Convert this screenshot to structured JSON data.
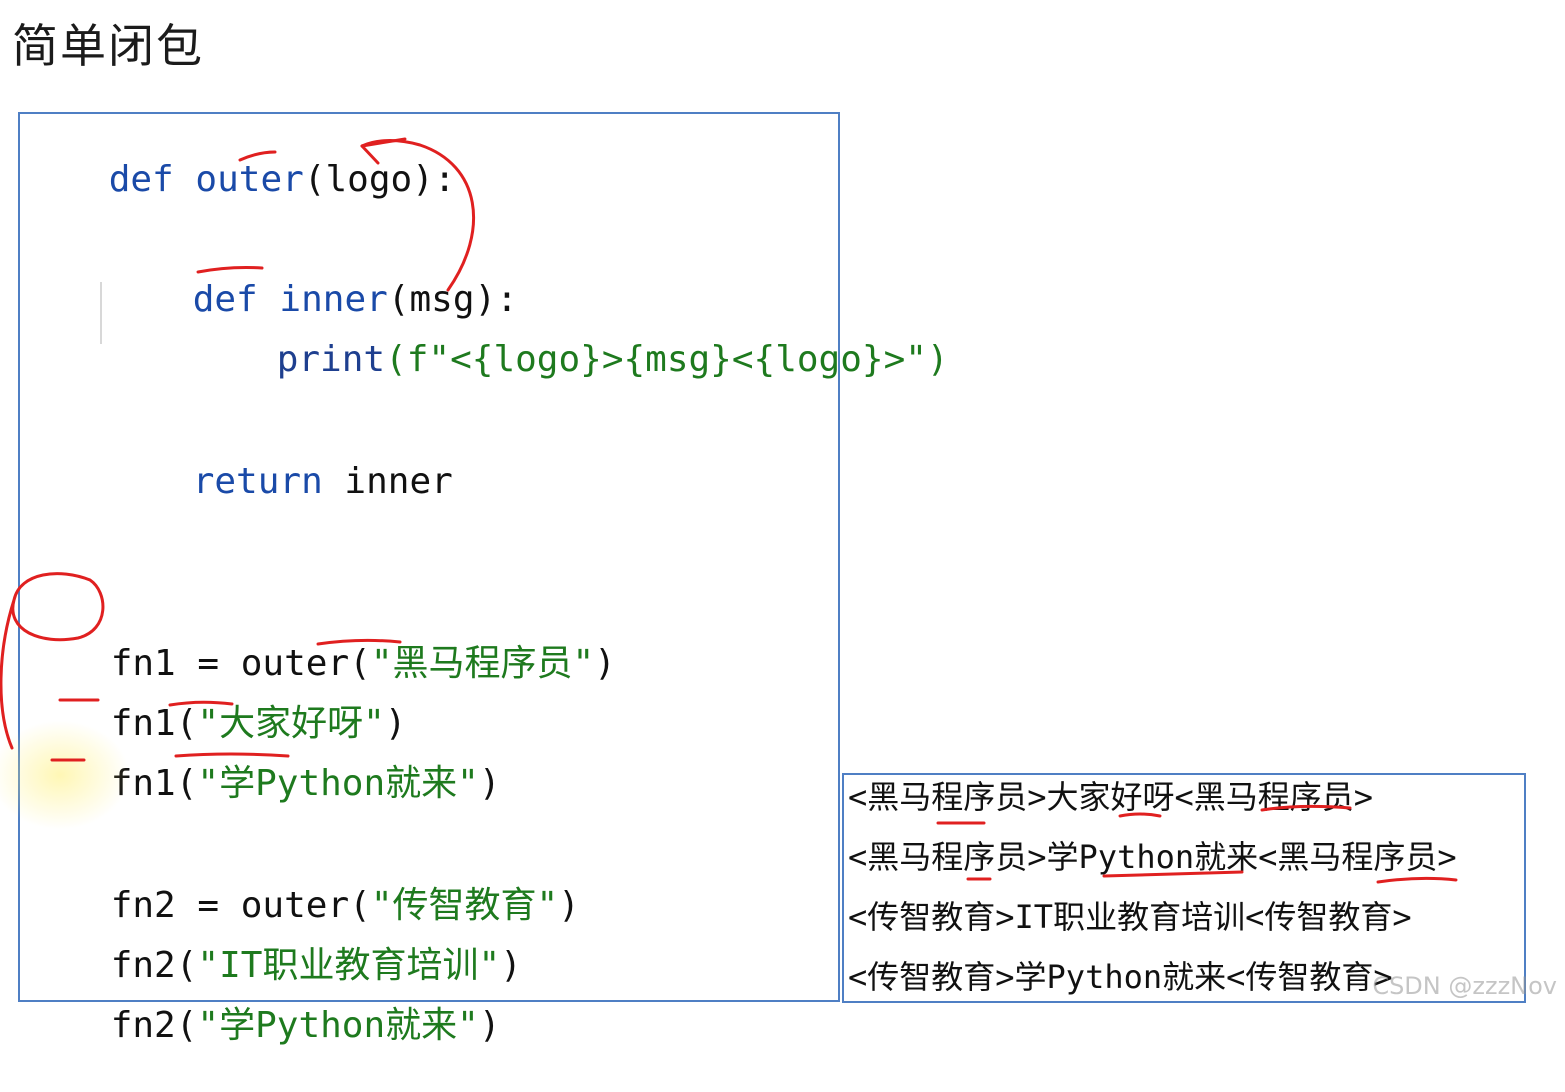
{
  "title": "简单闭包",
  "code": {
    "line1": {
      "kw": "def",
      "name": "outer",
      "rest": "(logo):"
    },
    "line2": {
      "kw": "def",
      "name": "inner",
      "rest": "(msg):"
    },
    "line3": {
      "call": "print",
      "args": "(f\"<{logo}>{msg}<{logo}>\")"
    },
    "line4": {
      "kw": "return",
      "rest": " inner"
    },
    "line5": {
      "lhs": "fn1 = ",
      "call": "outer",
      "open": "(",
      "str": "\"黑马程序员\"",
      "close": ")"
    },
    "line6": {
      "lhs": "fn1",
      "open": "(",
      "str": "\"大家好呀\"",
      "close": ")"
    },
    "line7": {
      "lhs": "fn1",
      "open": "(",
      "str": "\"学Python就来\"",
      "close": ")"
    },
    "line8": {
      "lhs": "fn2 = ",
      "call": "outer",
      "open": "(",
      "str": "\"传智教育\"",
      "close": ")"
    },
    "line9": {
      "lhs": "fn2",
      "open": "(",
      "str": "\"IT职业教育培训\"",
      "close": ")"
    },
    "line10": {
      "lhs": "fn2",
      "open": "(",
      "str": "\"学Python就来\"",
      "close": ")"
    }
  },
  "output": [
    "<黑马程序员>大家好呀<黑马程序员>",
    "<黑马程序员>学Python就来<黑马程序员>",
    "<传智教育>IT职业教育培训<传智教育>",
    "<传智教育>学Python就来<传智教育>"
  ],
  "watermark": "CSDN @zzzNov",
  "colors": {
    "annotation": "#e02020",
    "border": "#4f7fc4"
  }
}
